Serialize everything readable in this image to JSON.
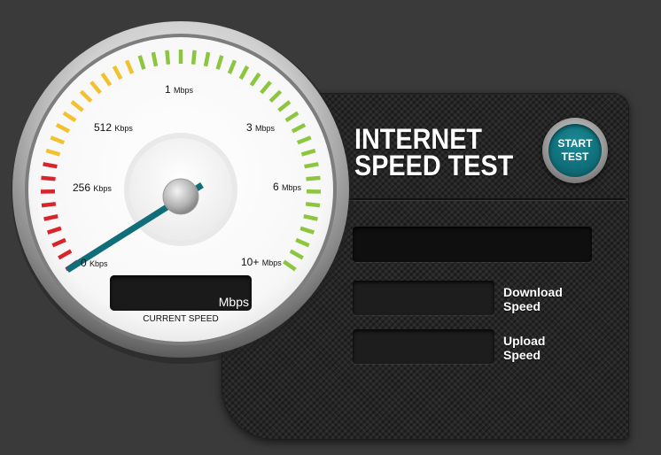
{
  "title": {
    "line1": "INTERNET",
    "line2": "SPEED TEST"
  },
  "start_button": {
    "label": "START TEST"
  },
  "gauge": {
    "labels": [
      {
        "value": "256",
        "unit": "Kbps"
      },
      {
        "value": "512",
        "unit": "Kbps"
      },
      {
        "value": "1",
        "unit": "Mbps"
      },
      {
        "value": "3",
        "unit": "Mbps"
      },
      {
        "value": "6",
        "unit": "Mbps"
      },
      {
        "value": "10+",
        "unit": "Mbps"
      },
      {
        "value": "0",
        "unit": "Kbps"
      }
    ],
    "display_unit": "Mbps",
    "caption": "CURRENT SPEED",
    "needle_fraction": 0.0
  },
  "results": {
    "main_value": "",
    "download_label": "Download Speed",
    "download_value": "",
    "upload_label": "Upload Speed",
    "upload_value": ""
  },
  "colors": {
    "accent": "#0f6e79",
    "background": "#3a3a3a",
    "tick_red": "#d8242a",
    "tick_yellow": "#f2c12e",
    "tick_green": "#8cc63f"
  }
}
